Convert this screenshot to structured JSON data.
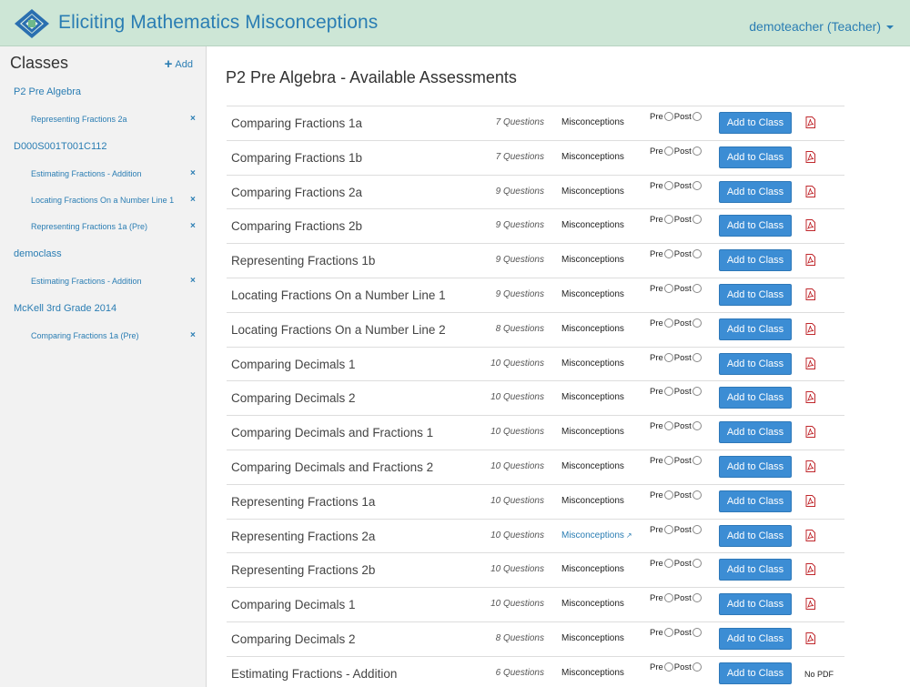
{
  "header": {
    "app_title": "Eliciting Mathematics Misconceptions",
    "user": "demoteacher (Teacher)"
  },
  "sidebar": {
    "heading": "Classes",
    "add_label": "Add",
    "classes": [
      {
        "name": "P2 Pre Algebra",
        "items": [
          "Representing Fractions 2a"
        ]
      },
      {
        "name": "D000S001T001C112",
        "items": [
          "Estimating Fractions - Addition",
          "Locating Fractions On a Number Line 1",
          "Representing Fractions 1a (Pre)"
        ]
      },
      {
        "name": "democlass",
        "items": [
          "Estimating Fractions - Addition"
        ]
      },
      {
        "name": "McKell 3rd Grade 2014",
        "items": [
          "Comparing Fractions 1a (Pre)"
        ]
      }
    ]
  },
  "main": {
    "title": "P2 Pre Algebra - Available Assessments",
    "labels": {
      "misconceptions": "Misconceptions",
      "pre": "Pre",
      "post": "Post",
      "add": "Add to Class",
      "no_pdf": "No PDF"
    },
    "assessments": [
      {
        "name": "Comparing Fractions 1a",
        "questions": "7 Questions",
        "pdf": true
      },
      {
        "name": "Comparing Fractions 1b",
        "questions": "7 Questions",
        "pdf": true
      },
      {
        "name": "Comparing Fractions 2a",
        "questions": "9 Questions",
        "pdf": true
      },
      {
        "name": "Comparing Fractions 2b",
        "questions": "9 Questions",
        "pdf": true
      },
      {
        "name": "Representing Fractions 1b",
        "questions": "9 Questions",
        "pdf": true
      },
      {
        "name": "Locating Fractions On a Number Line 1",
        "questions": "9 Questions",
        "pdf": true
      },
      {
        "name": "Locating Fractions On a Number Line 2",
        "questions": "8 Questions",
        "pdf": true
      },
      {
        "name": "Comparing Decimals 1",
        "questions": "10 Questions",
        "pdf": true
      },
      {
        "name": "Comparing Decimals 2",
        "questions": "10 Questions",
        "pdf": true
      },
      {
        "name": "Comparing Decimals and Fractions 1",
        "questions": "10 Questions",
        "pdf": true
      },
      {
        "name": "Comparing Decimals and Fractions 2",
        "questions": "10 Questions",
        "pdf": true
      },
      {
        "name": "Representing Fractions 1a",
        "questions": "10 Questions",
        "pdf": true
      },
      {
        "name": "Representing Fractions 2a",
        "questions": "10 Questions",
        "pdf": true,
        "misconceptions_link": true
      },
      {
        "name": "Representing Fractions 2b",
        "questions": "10 Questions",
        "pdf": true
      },
      {
        "name": "Comparing Decimals 1",
        "questions": "10 Questions",
        "pdf": true
      },
      {
        "name": "Comparing Decimals 2",
        "questions": "8 Questions",
        "pdf": true
      },
      {
        "name": "Estimating Fractions - Addition",
        "questions": "6 Questions",
        "pdf": false
      }
    ]
  },
  "colors": {
    "header_bg": "#cde6d6",
    "link": "#2a7db3",
    "button": "#3c8dd4",
    "pdf": "#c0282d"
  }
}
